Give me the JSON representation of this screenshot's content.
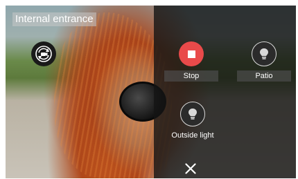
{
  "camera": {
    "title": "Internal entrance",
    "switch_icon": "camera-switch-icon"
  },
  "actions": [
    {
      "label": "Stop",
      "icon": "stop-icon",
      "color": "#e94a4a"
    },
    {
      "label": "Patio",
      "icon": "light-bulb-icon",
      "color": "#2b2b2b"
    },
    {
      "label": "Outside light",
      "icon": "light-bulb-icon",
      "color": "#2b2b2b"
    }
  ],
  "close": {
    "icon": "close-icon"
  }
}
